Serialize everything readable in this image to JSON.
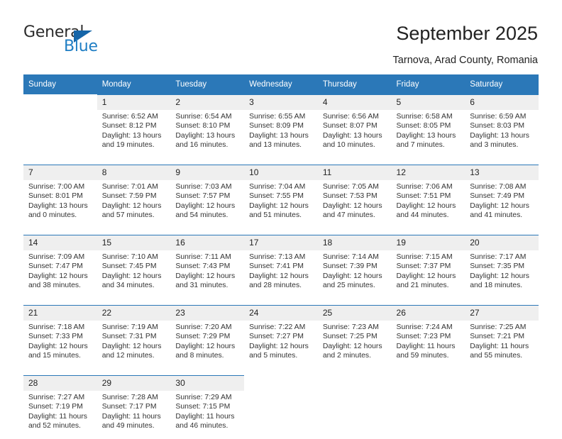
{
  "brand": {
    "name_top": "General",
    "name_bottom": "Blue",
    "triangle_color": "#1565a8",
    "blue_color": "#1f7ec4"
  },
  "header": {
    "title": "September 2025",
    "subtitle": "Tarnova, Arad County, Romania",
    "accent_color": "#2b78b8"
  },
  "calendar": {
    "weekday_headers": [
      "Sunday",
      "Monday",
      "Tuesday",
      "Wednesday",
      "Thursday",
      "Friday",
      "Saturday"
    ],
    "labels": {
      "sunrise": "Sunrise:",
      "sunset": "Sunset:",
      "daylight": "Daylight:"
    },
    "weeks": [
      [
        {
          "day": "",
          "empty": true,
          "sunrise": "",
          "sunset": "",
          "daylight_line1": "",
          "daylight_line2": ""
        },
        {
          "day": "1",
          "empty": false,
          "sunrise": "Sunrise: 6:52 AM",
          "sunset": "Sunset: 8:12 PM",
          "daylight_line1": "Daylight: 13 hours",
          "daylight_line2": "and 19 minutes."
        },
        {
          "day": "2",
          "empty": false,
          "sunrise": "Sunrise: 6:54 AM",
          "sunset": "Sunset: 8:10 PM",
          "daylight_line1": "Daylight: 13 hours",
          "daylight_line2": "and 16 minutes."
        },
        {
          "day": "3",
          "empty": false,
          "sunrise": "Sunrise: 6:55 AM",
          "sunset": "Sunset: 8:09 PM",
          "daylight_line1": "Daylight: 13 hours",
          "daylight_line2": "and 13 minutes."
        },
        {
          "day": "4",
          "empty": false,
          "sunrise": "Sunrise: 6:56 AM",
          "sunset": "Sunset: 8:07 PM",
          "daylight_line1": "Daylight: 13 hours",
          "daylight_line2": "and 10 minutes."
        },
        {
          "day": "5",
          "empty": false,
          "sunrise": "Sunrise: 6:58 AM",
          "sunset": "Sunset: 8:05 PM",
          "daylight_line1": "Daylight: 13 hours",
          "daylight_line2": "and 7 minutes."
        },
        {
          "day": "6",
          "empty": false,
          "sunrise": "Sunrise: 6:59 AM",
          "sunset": "Sunset: 8:03 PM",
          "daylight_line1": "Daylight: 13 hours",
          "daylight_line2": "and 3 minutes."
        }
      ],
      [
        {
          "day": "7",
          "empty": false,
          "sunrise": "Sunrise: 7:00 AM",
          "sunset": "Sunset: 8:01 PM",
          "daylight_line1": "Daylight: 13 hours",
          "daylight_line2": "and 0 minutes."
        },
        {
          "day": "8",
          "empty": false,
          "sunrise": "Sunrise: 7:01 AM",
          "sunset": "Sunset: 7:59 PM",
          "daylight_line1": "Daylight: 12 hours",
          "daylight_line2": "and 57 minutes."
        },
        {
          "day": "9",
          "empty": false,
          "sunrise": "Sunrise: 7:03 AM",
          "sunset": "Sunset: 7:57 PM",
          "daylight_line1": "Daylight: 12 hours",
          "daylight_line2": "and 54 minutes."
        },
        {
          "day": "10",
          "empty": false,
          "sunrise": "Sunrise: 7:04 AM",
          "sunset": "Sunset: 7:55 PM",
          "daylight_line1": "Daylight: 12 hours",
          "daylight_line2": "and 51 minutes."
        },
        {
          "day": "11",
          "empty": false,
          "sunrise": "Sunrise: 7:05 AM",
          "sunset": "Sunset: 7:53 PM",
          "daylight_line1": "Daylight: 12 hours",
          "daylight_line2": "and 47 minutes."
        },
        {
          "day": "12",
          "empty": false,
          "sunrise": "Sunrise: 7:06 AM",
          "sunset": "Sunset: 7:51 PM",
          "daylight_line1": "Daylight: 12 hours",
          "daylight_line2": "and 44 minutes."
        },
        {
          "day": "13",
          "empty": false,
          "sunrise": "Sunrise: 7:08 AM",
          "sunset": "Sunset: 7:49 PM",
          "daylight_line1": "Daylight: 12 hours",
          "daylight_line2": "and 41 minutes."
        }
      ],
      [
        {
          "day": "14",
          "empty": false,
          "sunrise": "Sunrise: 7:09 AM",
          "sunset": "Sunset: 7:47 PM",
          "daylight_line1": "Daylight: 12 hours",
          "daylight_line2": "and 38 minutes."
        },
        {
          "day": "15",
          "empty": false,
          "sunrise": "Sunrise: 7:10 AM",
          "sunset": "Sunset: 7:45 PM",
          "daylight_line1": "Daylight: 12 hours",
          "daylight_line2": "and 34 minutes."
        },
        {
          "day": "16",
          "empty": false,
          "sunrise": "Sunrise: 7:11 AM",
          "sunset": "Sunset: 7:43 PM",
          "daylight_line1": "Daylight: 12 hours",
          "daylight_line2": "and 31 minutes."
        },
        {
          "day": "17",
          "empty": false,
          "sunrise": "Sunrise: 7:13 AM",
          "sunset": "Sunset: 7:41 PM",
          "daylight_line1": "Daylight: 12 hours",
          "daylight_line2": "and 28 minutes."
        },
        {
          "day": "18",
          "empty": false,
          "sunrise": "Sunrise: 7:14 AM",
          "sunset": "Sunset: 7:39 PM",
          "daylight_line1": "Daylight: 12 hours",
          "daylight_line2": "and 25 minutes."
        },
        {
          "day": "19",
          "empty": false,
          "sunrise": "Sunrise: 7:15 AM",
          "sunset": "Sunset: 7:37 PM",
          "daylight_line1": "Daylight: 12 hours",
          "daylight_line2": "and 21 minutes."
        },
        {
          "day": "20",
          "empty": false,
          "sunrise": "Sunrise: 7:17 AM",
          "sunset": "Sunset: 7:35 PM",
          "daylight_line1": "Daylight: 12 hours",
          "daylight_line2": "and 18 minutes."
        }
      ],
      [
        {
          "day": "21",
          "empty": false,
          "sunrise": "Sunrise: 7:18 AM",
          "sunset": "Sunset: 7:33 PM",
          "daylight_line1": "Daylight: 12 hours",
          "daylight_line2": "and 15 minutes."
        },
        {
          "day": "22",
          "empty": false,
          "sunrise": "Sunrise: 7:19 AM",
          "sunset": "Sunset: 7:31 PM",
          "daylight_line1": "Daylight: 12 hours",
          "daylight_line2": "and 12 minutes."
        },
        {
          "day": "23",
          "empty": false,
          "sunrise": "Sunrise: 7:20 AM",
          "sunset": "Sunset: 7:29 PM",
          "daylight_line1": "Daylight: 12 hours",
          "daylight_line2": "and 8 minutes."
        },
        {
          "day": "24",
          "empty": false,
          "sunrise": "Sunrise: 7:22 AM",
          "sunset": "Sunset: 7:27 PM",
          "daylight_line1": "Daylight: 12 hours",
          "daylight_line2": "and 5 minutes."
        },
        {
          "day": "25",
          "empty": false,
          "sunrise": "Sunrise: 7:23 AM",
          "sunset": "Sunset: 7:25 PM",
          "daylight_line1": "Daylight: 12 hours",
          "daylight_line2": "and 2 minutes."
        },
        {
          "day": "26",
          "empty": false,
          "sunrise": "Sunrise: 7:24 AM",
          "sunset": "Sunset: 7:23 PM",
          "daylight_line1": "Daylight: 11 hours",
          "daylight_line2": "and 59 minutes."
        },
        {
          "day": "27",
          "empty": false,
          "sunrise": "Sunrise: 7:25 AM",
          "sunset": "Sunset: 7:21 PM",
          "daylight_line1": "Daylight: 11 hours",
          "daylight_line2": "and 55 minutes."
        }
      ],
      [
        {
          "day": "28",
          "empty": false,
          "sunrise": "Sunrise: 7:27 AM",
          "sunset": "Sunset: 7:19 PM",
          "daylight_line1": "Daylight: 11 hours",
          "daylight_line2": "and 52 minutes."
        },
        {
          "day": "29",
          "empty": false,
          "sunrise": "Sunrise: 7:28 AM",
          "sunset": "Sunset: 7:17 PM",
          "daylight_line1": "Daylight: 11 hours",
          "daylight_line2": "and 49 minutes."
        },
        {
          "day": "30",
          "empty": false,
          "sunrise": "Sunrise: 7:29 AM",
          "sunset": "Sunset: 7:15 PM",
          "daylight_line1": "Daylight: 11 hours",
          "daylight_line2": "and 46 minutes."
        },
        {
          "day": "",
          "empty": true,
          "sunrise": "",
          "sunset": "",
          "daylight_line1": "",
          "daylight_line2": ""
        },
        {
          "day": "",
          "empty": true,
          "sunrise": "",
          "sunset": "",
          "daylight_line1": "",
          "daylight_line2": ""
        },
        {
          "day": "",
          "empty": true,
          "sunrise": "",
          "sunset": "",
          "daylight_line1": "",
          "daylight_line2": ""
        },
        {
          "day": "",
          "empty": true,
          "sunrise": "",
          "sunset": "",
          "daylight_line1": "",
          "daylight_line2": ""
        }
      ]
    ]
  }
}
